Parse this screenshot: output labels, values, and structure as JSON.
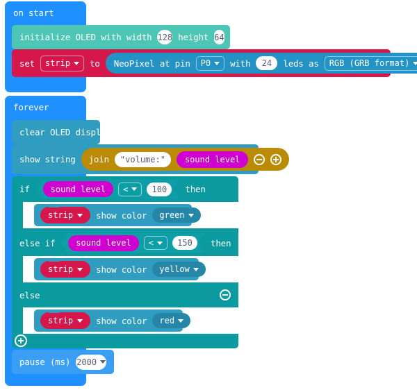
{
  "editor": {
    "background": "#ffffff",
    "colors": {
      "event_blue": "#1e90ff",
      "event_blue_dark": "#3aa0ff",
      "oled_teal": "#4ec6b6",
      "variable_red": "#d6174b",
      "neopixel_blue": "#2293c4",
      "loop_teal": "#0e9e9e",
      "light_teal_block": "#2f9cc0",
      "join_gold": "#bb8b06",
      "sensor_magenta": "#d000d0",
      "logic_teal": "#0a9aa0"
    }
  },
  "scripts": [
    {
      "id": "on-start",
      "hat_label": "on start",
      "blocks": [
        {
          "id": "init-oled",
          "type": "oled",
          "parts": [
            {
              "kind": "label",
              "text": "initialize OLED with width"
            },
            {
              "kind": "number",
              "value": "128"
            },
            {
              "kind": "label",
              "text": "height"
            },
            {
              "kind": "number",
              "value": "64"
            }
          ]
        },
        {
          "id": "set-strip",
          "type": "variable",
          "parts": [
            {
              "kind": "label",
              "text": "set"
            },
            {
              "kind": "dropdown",
              "value": "strip"
            },
            {
              "kind": "label",
              "text": "to"
            }
          ],
          "reporter": {
            "id": "neopixel-create",
            "parts": [
              {
                "kind": "label",
                "text": "NeoPixel at pin"
              },
              {
                "kind": "dropdown",
                "value": "P0"
              },
              {
                "kind": "label",
                "text": "with"
              },
              {
                "kind": "number",
                "value": "24"
              },
              {
                "kind": "label",
                "text": "leds as"
              },
              {
                "kind": "dropdown",
                "value": "RGB (GRB format)"
              }
            ]
          }
        }
      ]
    },
    {
      "id": "forever",
      "hat_label": "forever",
      "blocks": [
        {
          "id": "clear-oled",
          "type": "oled",
          "parts": [
            {
              "kind": "label",
              "text": "clear OLED display"
            }
          ]
        },
        {
          "id": "show-string",
          "type": "oled",
          "parts": [
            {
              "kind": "label",
              "text": "show string"
            }
          ],
          "join": {
            "label": "join",
            "string_value": "\"volume:\"",
            "reporter": "sound level",
            "minus_icon": "minus-circle-icon",
            "plus_icon": "plus-circle-icon"
          }
        },
        {
          "id": "if-block",
          "type": "logic",
          "branches": [
            {
              "keyword": "if",
              "then_label": "then",
              "condition": {
                "left": "sound level",
                "operator": "<",
                "right": "100"
              },
              "has_minus": false,
              "body": {
                "id": "show-color-green",
                "variable": "strip",
                "label": "show color",
                "color": "green"
              }
            },
            {
              "keyword": "else if",
              "then_label": "then",
              "condition": {
                "left": "sound level",
                "operator": "<",
                "right": "150"
              },
              "has_minus": true,
              "body": {
                "id": "show-color-yellow",
                "variable": "strip",
                "label": "show color",
                "color": "yellow"
              }
            },
            {
              "keyword": "else",
              "then_label": "",
              "condition": null,
              "has_minus": true,
              "body": {
                "id": "show-color-red",
                "variable": "strip",
                "label": "show color",
                "color": "red"
              }
            }
          ],
          "footer_plus_icon": "plus-circle-icon"
        },
        {
          "id": "pause",
          "type": "loop",
          "parts": [
            {
              "kind": "label",
              "text": "pause (ms)"
            },
            {
              "kind": "dropdown_number",
              "value": "2000"
            }
          ]
        }
      ]
    }
  ]
}
